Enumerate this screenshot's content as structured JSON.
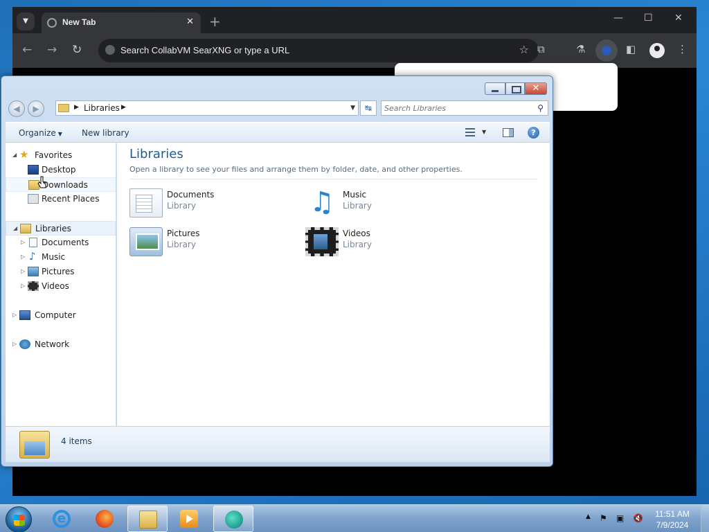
{
  "browser": {
    "tab_title": "New Tab",
    "tab_close": "✕",
    "new_tab": "+",
    "omnibox_placeholder": "Search CollabVM SearXNG or type a URL",
    "icons": [
      "tab-search-icon",
      "globe-icon",
      "back-icon",
      "forward-icon",
      "reload-icon",
      "site-info-icon",
      "bookmark-star-icon",
      "extensions-icon",
      "labs-icon",
      "side-panel-icon",
      "profile-icon",
      "menu-icon"
    ]
  },
  "explorer": {
    "address": {
      "crumb": "Libraries",
      "arrow": "▶"
    },
    "search_placeholder": "Search Libraries",
    "toolbar": {
      "organize": "Organize",
      "new_library": "New library",
      "help": "?"
    },
    "nav": {
      "favorites": "Favorites",
      "desktop": "Desktop",
      "downloads": "Downloads",
      "recent": "Recent Places",
      "libraries": "Libraries",
      "documents": "Documents",
      "music": "Music",
      "pictures": "Pictures",
      "videos": "Videos",
      "computer": "Computer",
      "network": "Network"
    },
    "content": {
      "heading": "Libraries",
      "subtitle": "Open a library to see your files and arrange them by folder, date, and other properties.",
      "items": [
        {
          "name": "Documents",
          "type": "Library"
        },
        {
          "name": "Music",
          "type": "Library"
        },
        {
          "name": "Pictures",
          "type": "Library"
        },
        {
          "name": "Videos",
          "type": "Library"
        }
      ]
    },
    "details": {
      "count": "4 items"
    }
  },
  "taskbar": {
    "time": "11:51 AM",
    "date": "7/9/2024",
    "apps": [
      "internet-explorer",
      "firefox",
      "windows-explorer",
      "media-player",
      "collabvm"
    ]
  },
  "colors": {
    "heading": "#1e5b96",
    "chrome_bg": "#202124",
    "taskbar": "#7fa3cc"
  }
}
